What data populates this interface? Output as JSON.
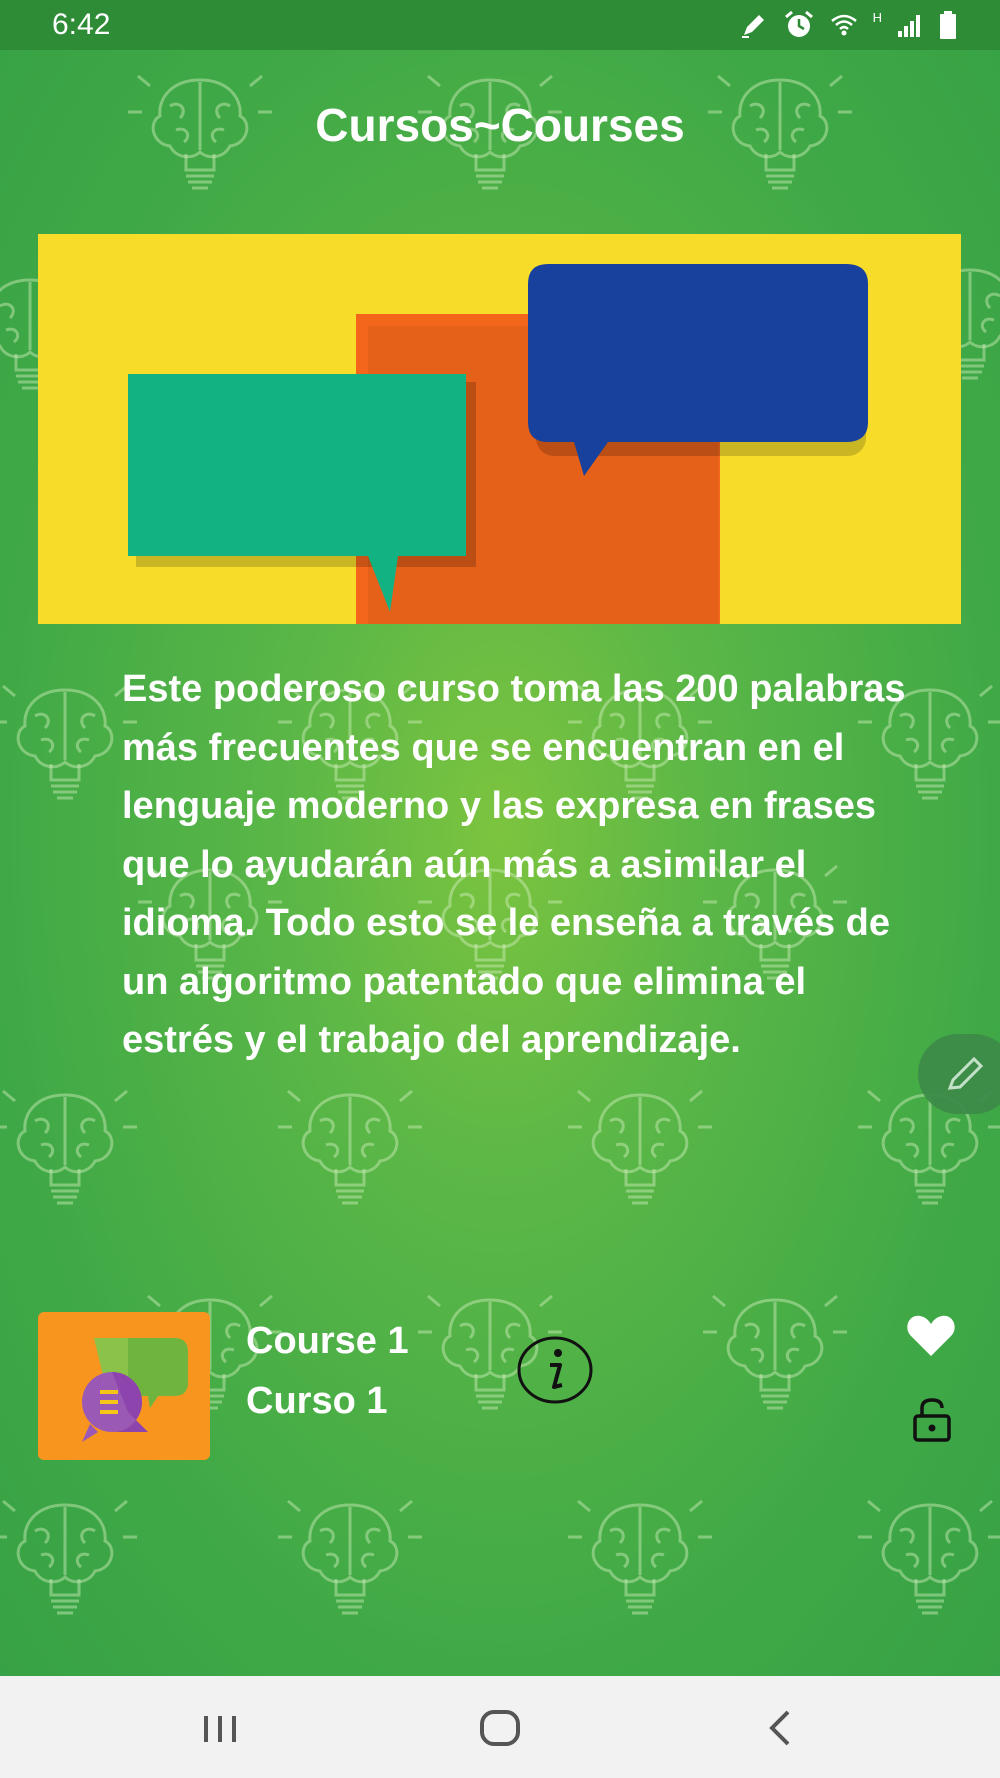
{
  "status_bar": {
    "time": "6:42",
    "network_label": "H",
    "icons": [
      "edit-icon",
      "alarm-icon",
      "wifi-icon",
      "signal-icon",
      "battery-icon"
    ]
  },
  "header": {
    "title": "Cursos~Courses"
  },
  "banner": {
    "image": "speech-bubbles-illustration"
  },
  "description": {
    "text": "Este poderoso curso toma las 200 palabras más frecuentes que se encuentran en el lenguaje moderno y las expresa en frases que lo ayudarán aún más a asimilar el idioma. Todo esto se le enseña a través de un algoritmo patentado que elimina el estrés y el trabajo del aprendizaje."
  },
  "course": {
    "title": "Course 1",
    "subtitle": "Curso 1",
    "icons": [
      "info-icon",
      "heart-icon",
      "lock-icon"
    ]
  },
  "colors": {
    "status_bar": "#2e8c36",
    "background": "#45ad46",
    "thumbnail": "#f7951e",
    "banner_yellow": "#f7dd2a",
    "banner_orange": "#f4661b",
    "banner_teal": "#13b283",
    "banner_blue": "#17419c"
  },
  "nav_bar": {
    "buttons": [
      "recent-apps",
      "home",
      "back"
    ]
  }
}
